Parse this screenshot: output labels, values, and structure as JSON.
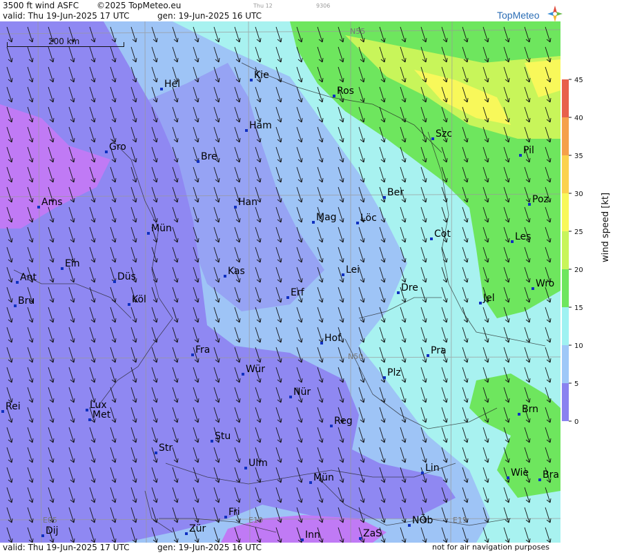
{
  "header": {
    "title": "3500 ft wind ASFC",
    "copyright": "©2025 TopMeteo.eu",
    "valid_label": "valid:  Thu  19-Jun-2025  17 UTC",
    "gen_label": "gen: 19-Jun-2025 16 UTC",
    "small_date": "Thu 12",
    "small_code": "9306",
    "logo_text": "TopMeteo"
  },
  "footer": {
    "valid_label": "valid:  Thu  19-Jun-2025  17 UTC",
    "gen_label": "gen: 19-Jun-2025 16 UTC",
    "disclaimer": "not for air navigation purposes"
  },
  "scale": {
    "label": "200 km"
  },
  "grid_labels": {
    "n55": "N55",
    "n50": "N50",
    "e05": "E05",
    "e10": "E10",
    "e15": "E15"
  },
  "legend": {
    "title": "wind speed  [kt]",
    "ticks": [
      "45",
      "40",
      "35",
      "30",
      "25",
      "20",
      "15",
      "10",
      "5",
      "0"
    ],
    "colors": [
      "#e8604a",
      "#f5a04a",
      "#fbd24d",
      "#f8f85a",
      "#c8f55a",
      "#6ee65e",
      "#9ff2f2",
      "#9ec8f8",
      "#8a82f0",
      "#c07af5"
    ]
  },
  "cities": [
    {
      "name": "Hel"
    },
    {
      "name": "Kie"
    },
    {
      "name": "Ros"
    },
    {
      "name": "Ham"
    },
    {
      "name": "Szc"
    },
    {
      "name": "Gro"
    },
    {
      "name": "Bre"
    },
    {
      "name": "Pil"
    },
    {
      "name": "Ber"
    },
    {
      "name": "Ams"
    },
    {
      "name": "Han"
    },
    {
      "name": "Poz"
    },
    {
      "name": "Mag"
    },
    {
      "name": "Löc"
    },
    {
      "name": "Mün"
    },
    {
      "name": "Cot"
    },
    {
      "name": "Les"
    },
    {
      "name": "Ein"
    },
    {
      "name": "Kas"
    },
    {
      "name": "Lei"
    },
    {
      "name": "Ant"
    },
    {
      "name": "Düs"
    },
    {
      "name": "Dre"
    },
    {
      "name": "Wro"
    },
    {
      "name": "Erf"
    },
    {
      "name": "Bru"
    },
    {
      "name": "Köl"
    },
    {
      "name": "Jel"
    },
    {
      "name": "Hof"
    },
    {
      "name": "Fra"
    },
    {
      "name": "Pra"
    },
    {
      "name": "Wür"
    },
    {
      "name": "Plz"
    },
    {
      "name": "Lux"
    },
    {
      "name": "Nür"
    },
    {
      "name": "Rei"
    },
    {
      "name": "Met"
    },
    {
      "name": "Brn"
    },
    {
      "name": "Reg"
    },
    {
      "name": "Stu"
    },
    {
      "name": "Str"
    },
    {
      "name": "Ulm"
    },
    {
      "name": "Lin"
    },
    {
      "name": "Mün"
    },
    {
      "name": "Wie"
    },
    {
      "name": "Bra"
    },
    {
      "name": "Fri"
    },
    {
      "name": "NÖb"
    },
    {
      "name": "Dij"
    },
    {
      "name": "Zür"
    },
    {
      "name": "Inn"
    },
    {
      "name": "ZaS"
    }
  ]
}
